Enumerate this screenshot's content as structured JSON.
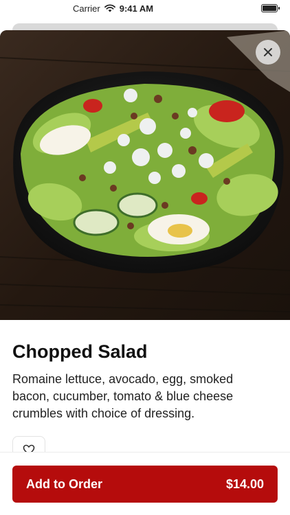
{
  "status_bar": {
    "carrier": "Carrier",
    "time": "9:41 AM"
  },
  "item": {
    "title": "Chopped Salad",
    "description": "Romaine lettuce, avocado, egg, smoked bacon, cucumber, tomato & blue cheese crumbles with choice of dressing."
  },
  "actions": {
    "add_label": "Add to Order",
    "price": "$14.00",
    "accent_color": "#b50c0c"
  },
  "icons": {
    "close": "close-icon",
    "favorite": "heart-icon",
    "wifi": "wifi-icon",
    "battery": "battery-icon"
  }
}
